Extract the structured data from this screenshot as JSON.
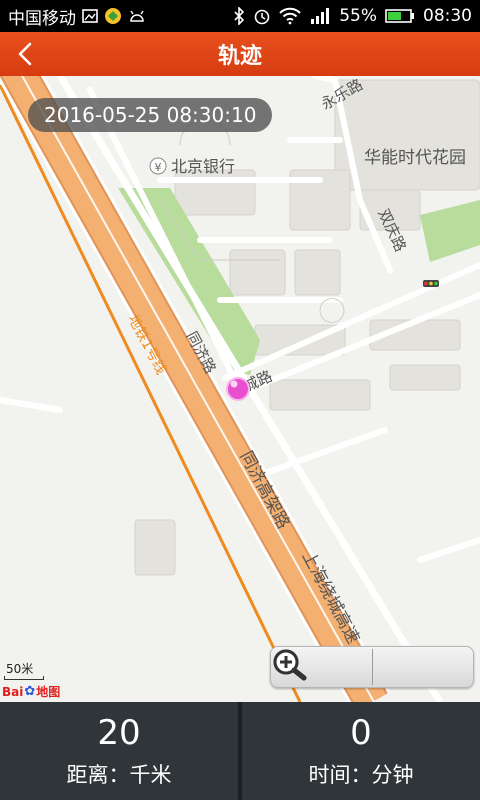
{
  "statusbar": {
    "carrier": "中国移动",
    "battery": "55%",
    "time": "08:30",
    "icons": [
      "image-icon",
      "app-icon",
      "android-icon",
      "bluetooth-icon",
      "alarm-icon",
      "wifi-icon",
      "signal-icon",
      "battery-icon"
    ]
  },
  "header": {
    "title": "轨迹",
    "back_icon": "chevron-left-icon"
  },
  "map": {
    "timestamp": "2016-05-25  08:30:10",
    "scale_label": "50米",
    "logo": {
      "brand": "Bai",
      "mark": "地图"
    },
    "labels": {
      "road_yongle": "永乐路",
      "poi_hueneng": "华能时代花园",
      "road_shuangqing": "双庆路",
      "poi_bank": "北京银行",
      "road_tongji": "同济路",
      "road_cheng": "城路",
      "road_viaduct": "同济高架路",
      "road_ring": "上海绕城高速",
      "metro": "地铁1号线"
    },
    "marker_color": "#e84fd0",
    "zoom": {
      "out_icon": "zoom-out-icon",
      "in_icon": "zoom-in-icon"
    }
  },
  "stats": {
    "distance": {
      "value": "20",
      "label": "距离：千米"
    },
    "duration": {
      "value": "0",
      "label": "时间：分钟"
    }
  },
  "colors": {
    "title_bar": "#e04a1a",
    "highway": "#f4a35a",
    "metro_line": "#f08a1c",
    "park": "#b8dc9c",
    "panel": "#2f3539"
  }
}
